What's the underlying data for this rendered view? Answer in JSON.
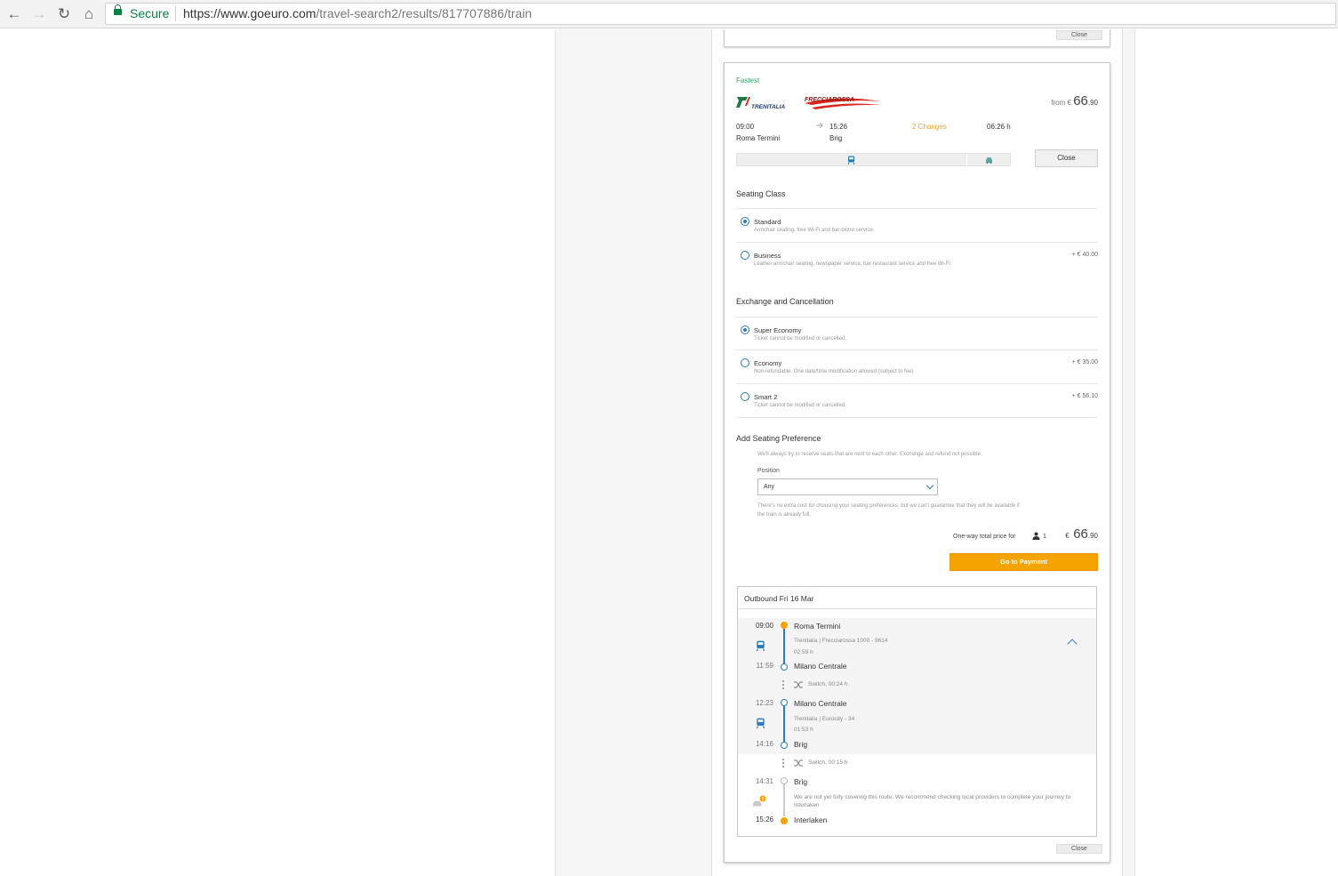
{
  "browser": {
    "secure_label": "Secure",
    "url_host": "https://www.goeuro.com",
    "url_path": "/travel-search2/results/817707886/train"
  },
  "prev_card": {
    "close_label": "Close"
  },
  "result": {
    "tag": "Fastest",
    "operator_logo": "TRENITALIA",
    "brand_logo": "FRECCIAROSSA",
    "price_from": "from €",
    "price_int": "66",
    "price_cents": ".90",
    "dep_time": "09:00",
    "dep_station": "Roma Termini",
    "arr_time": "15:26",
    "arr_station": "Brig",
    "changes": "2 Changes",
    "duration": "06:26 h",
    "close_label": "Close",
    "icons": [
      "train-icon",
      "bus-icon"
    ]
  },
  "seating_class": {
    "title": "Seating Class",
    "options": [
      {
        "title": "Standard",
        "desc": "Armchair seating, free Wi-Fi and bar-bistro service.",
        "price": "",
        "checked": true
      },
      {
        "title": "Business",
        "desc": "Leather armchair seating, newspaper service, bar-restaurant service and free Wi-Fi.",
        "price": "+ € 40.00",
        "checked": false
      }
    ]
  },
  "exchange": {
    "title": "Exchange and Cancellation",
    "options": [
      {
        "title": "Super Economy",
        "desc": "Ticket cannot be modified or cancelled.",
        "price": "",
        "checked": true
      },
      {
        "title": "Economy",
        "desc": "Non-refundable. One date/time modification allowed (subject to fee)",
        "price": "+ € 35.00",
        "checked": false
      },
      {
        "title": "Smart 2",
        "desc": "Ticket cannot be modified or cancelled.",
        "price": "+ € 56.10",
        "checked": false
      }
    ]
  },
  "seating_pref": {
    "title": "Add Seating Preference",
    "info": "We'll always try to reserve seats that are next to each other. Exchange and refund not possible.",
    "position_label": "Position",
    "position_value": "Any",
    "note_line1": "There's no extra cost for choosing your seating preferences, but we can't guarantee that they will be available if",
    "note_line2": "the train is already full."
  },
  "total": {
    "label": "One-way total price for",
    "passengers": "1",
    "currency": "€",
    "price_int": "66",
    "price_cents": ".90",
    "pay_label": "Go to Payment"
  },
  "outbound": {
    "title": "Outbound Fri 16 Mar",
    "leg1": {
      "dep_time": "09:00",
      "dep_station": "Roma Termini",
      "operator": "Trenitalia | Frecciarossa 1000 - 9614",
      "duration": "02:59 h",
      "arr_time": "11:59",
      "arr_station": "Milano Centrale"
    },
    "switch1": "Switch, 00:24 h",
    "leg2": {
      "dep_time": "12:23",
      "dep_station": "Milano Centrale",
      "operator": "Trenitalia | Eurocity - 34",
      "duration": "01:53 h",
      "arr_time": "14:16",
      "arr_station": "Brig"
    },
    "switch2": "Switch, 00:15 h",
    "leg3": {
      "dep_time": "14:31",
      "dep_station": "Brig",
      "warning": "We are not yet fully covering this route. We recommend checking local providers to complete your journey to Interlaken",
      "arr_time": "15:26",
      "arr_station": "Interlaken"
    }
  },
  "bottom_close_label": "Close",
  "colors": {
    "accent": "#2c7bb6",
    "orange": "#f5a300",
    "green": "#3aa169",
    "changes": "#f0a026"
  }
}
